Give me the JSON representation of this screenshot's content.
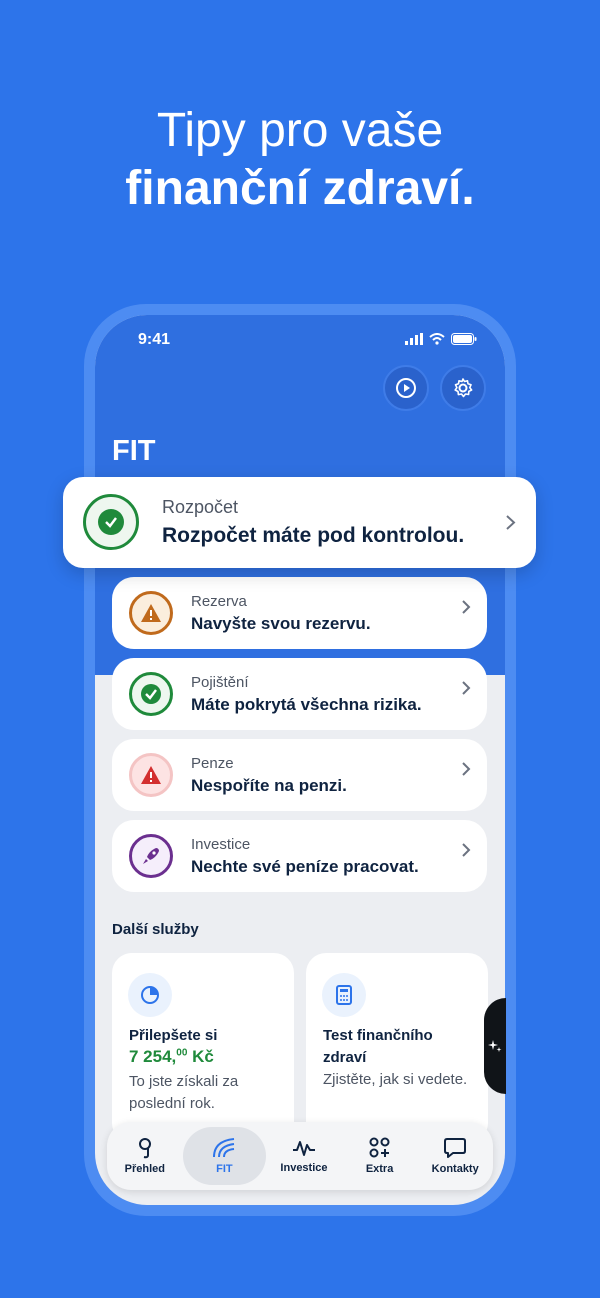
{
  "headline": {
    "line1": "Tipy pro vaše",
    "line2": "finanční zdraví."
  },
  "status": {
    "time": "9:41"
  },
  "screen": {
    "title": "FIT"
  },
  "hero_card": {
    "category": "Rozpočet",
    "text": "Rozpočet máte pod kontrolou.",
    "icon": "check-icon",
    "color": "#1f8a3b"
  },
  "cards": [
    {
      "category": "Rezerva",
      "text": "Navyšte svou rezervu.",
      "icon": "warning-icon",
      "color": "#c06a1c"
    },
    {
      "category": "Pojištění",
      "text": "Máte pokrytá všechna rizika.",
      "icon": "check-icon",
      "color": "#1f8a3b"
    },
    {
      "category": "Penze",
      "text": "Nespoříte na penzi.",
      "icon": "alert-icon",
      "color": "#d32f2f"
    },
    {
      "category": "Investice",
      "text": "Nechte své peníze pracovat.",
      "icon": "rocket-icon",
      "color": "#6b2f8f"
    }
  ],
  "services": {
    "title": "Další služby",
    "items": [
      {
        "title": "Přilepšete si",
        "amount_main": "7 254,",
        "amount_dec": "00",
        "amount_unit": " Kč",
        "sub": "To jste získali za poslední rok.",
        "icon": "pie-chart-icon"
      },
      {
        "title": "Test finančního zdraví",
        "sub": "Zjistěte, jak si vedete.",
        "icon": "calculator-icon"
      }
    ]
  },
  "tabs": [
    {
      "label": "Přehled",
      "icon": "overview-icon"
    },
    {
      "label": "FIT",
      "icon": "fit-icon",
      "active": true
    },
    {
      "label": "Investice",
      "icon": "pulse-icon"
    },
    {
      "label": "Extra",
      "icon": "grid-plus-icon"
    },
    {
      "label": "Kontakty",
      "icon": "chat-icon"
    }
  ],
  "colors": {
    "brand": "#2d74ea",
    "navy": "#0f2340",
    "green": "#1f8a3b"
  }
}
